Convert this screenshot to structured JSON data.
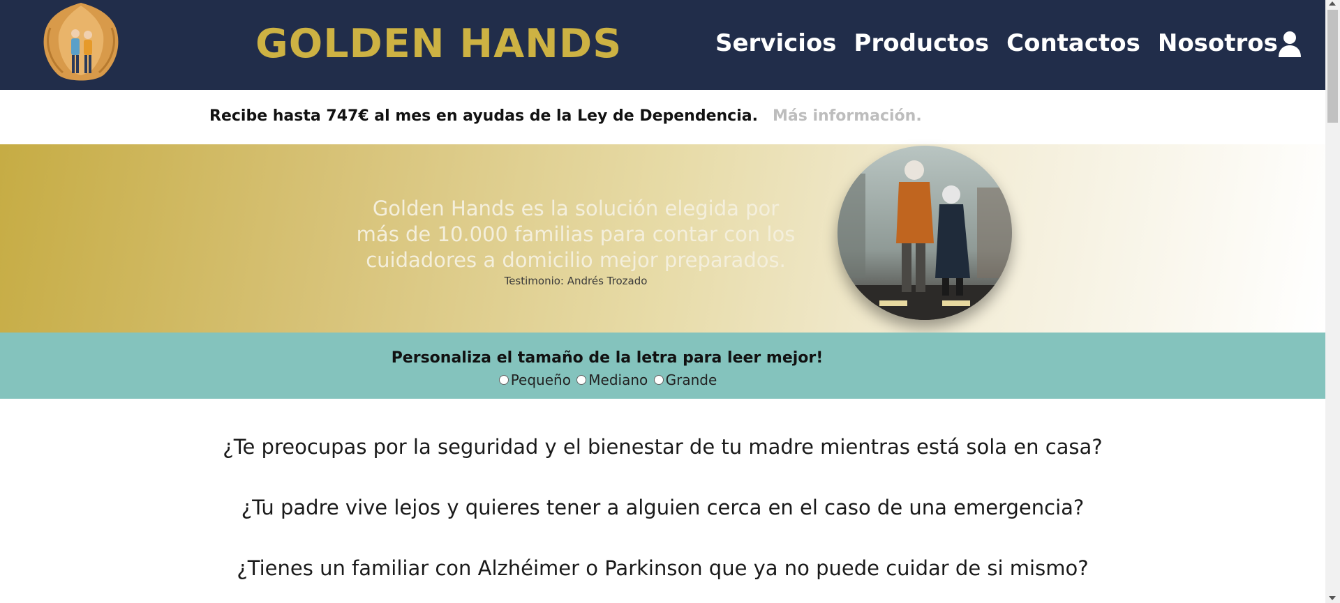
{
  "header": {
    "brand": "GOLDEN HANDS",
    "nav": [
      "Servicios",
      "Productos",
      "Contactos",
      "Nosotros"
    ],
    "user_icon": "user-icon",
    "logo_icon": "golden-hands-logo"
  },
  "info": {
    "text": "Recibe hasta 747€ al mes en ayudas de la Ley de Dependencia.",
    "link": "Más información."
  },
  "hero": {
    "quote": "Golden Hands es la solución elegida por más de 10.000 familias para contar con los cuidadores a domicilio mejor preparados.",
    "citation": "Testimonio: Andrés Trozado"
  },
  "font_selector": {
    "title": "Personaliza el tamaño de la letra para leer mejor!",
    "options": [
      "Pequeño",
      "Mediano",
      "Grande"
    ]
  },
  "questions": [
    "¿Te preocupas por la seguridad y el bienestar de tu madre mientras está sola en casa?",
    "¿Tu padre vive lejos y quieres tener a alguien cerca en el caso de una emergencia?",
    "¿Tienes un familiar con Alzhéimer o Parkinson que ya no puede cuidar de si mismo?"
  ],
  "colors": {
    "header_bg": "#212d4a",
    "brand_gold": "#cdb243",
    "font_bar_bg": "#84c3bd"
  }
}
